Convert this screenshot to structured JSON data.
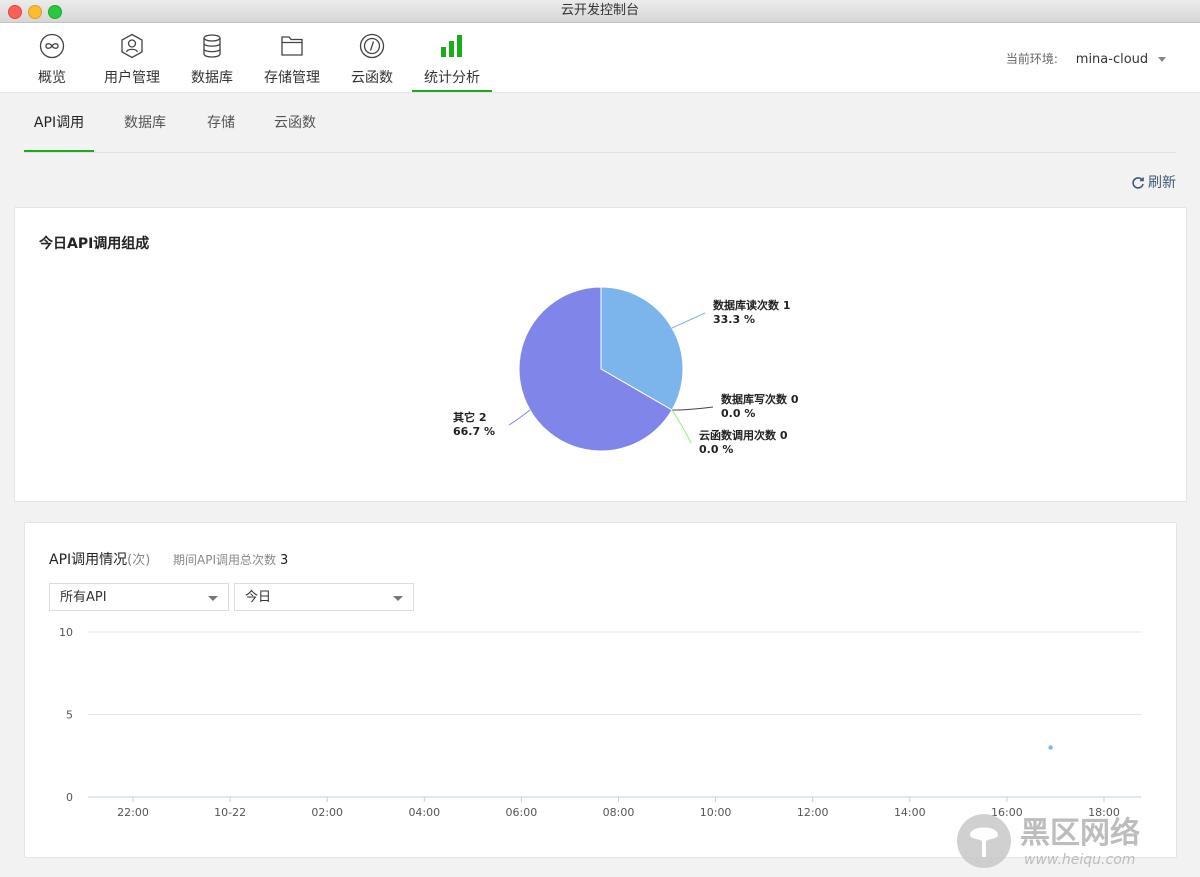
{
  "window": {
    "title": "云开发控制台"
  },
  "nav": {
    "items": [
      {
        "label": "概览",
        "icon": "infinity-icon"
      },
      {
        "label": "用户管理",
        "icon": "users-icon"
      },
      {
        "label": "数据库",
        "icon": "database-icon"
      },
      {
        "label": "存储管理",
        "icon": "folder-icon"
      },
      {
        "label": "云函数",
        "icon": "function-icon"
      },
      {
        "label": "统计分析",
        "icon": "bar-chart-icon",
        "active": true
      }
    ],
    "env_label": "当前环境:",
    "env_value": "mina-cloud"
  },
  "subtabs": [
    {
      "label": "API调用",
      "active": true
    },
    {
      "label": "数据库"
    },
    {
      "label": "存储"
    },
    {
      "label": "云函数"
    }
  ],
  "refresh_label": "刷新",
  "pie_card": {
    "title": "今日API调用组成"
  },
  "line_card": {
    "title": "API调用情况",
    "unit": "(次)",
    "total_label": "期间API调用总次数",
    "total_value": "3",
    "filters": {
      "api": "所有API",
      "range": "今日"
    }
  },
  "colors": {
    "accent": "#1aad19",
    "pie_read": "#7cb5ec",
    "pie_other": "#8085e9",
    "pie_write": "#434348",
    "pie_func": "#90ed7d"
  },
  "chart_data": [
    {
      "type": "pie",
      "title": "今日API调用组成",
      "slices": [
        {
          "name": "数据库读次数",
          "value": 1,
          "percent": "33.3 %"
        },
        {
          "name": "数据库写次数",
          "value": 0,
          "percent": "0.0 %"
        },
        {
          "name": "云函数调用次数",
          "value": 0,
          "percent": "0.0 %"
        },
        {
          "name": "其它",
          "value": 2,
          "percent": "66.7 %"
        }
      ]
    },
    {
      "type": "scatter",
      "title": "API调用情况",
      "x_ticks": [
        "22:00",
        "10-22",
        "02:00",
        "04:00",
        "06:00",
        "08:00",
        "10:00",
        "12:00",
        "14:00",
        "16:00",
        "18:00"
      ],
      "y_ticks": [
        0,
        5,
        10
      ],
      "ylim": [
        0,
        10
      ],
      "grid": true,
      "points": [
        {
          "x": "16:54",
          "y": 3
        }
      ]
    }
  ],
  "watermark": {
    "text": "黑区网络",
    "url": "www.heiqu.com"
  }
}
